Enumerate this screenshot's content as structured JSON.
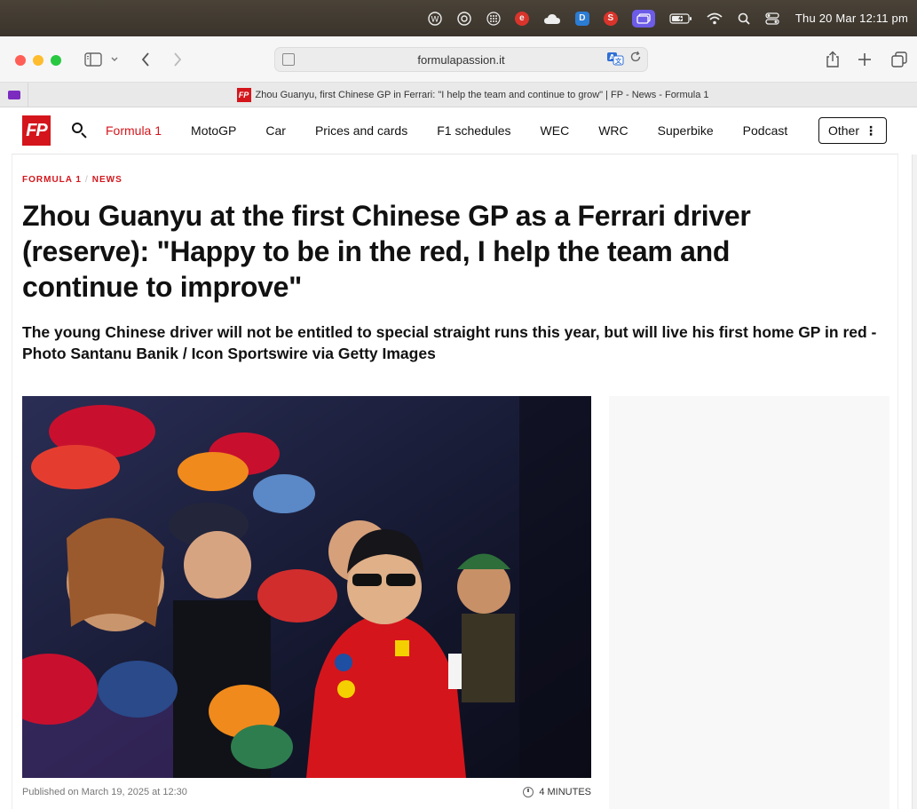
{
  "menubar": {
    "icons": [
      "wordpress-icon",
      "creative-cloud-icon",
      "grid-icon",
      "e-icon",
      "cloud-icon",
      "d-icon",
      "s-icon",
      "window-icon",
      "battery-icon",
      "wifi-icon",
      "search-icon",
      "control-center-icon"
    ],
    "e_label": "e",
    "d_label": "D",
    "s_label": "S",
    "clock": "Thu 20 Mar  12:11 pm"
  },
  "browser": {
    "url": "formulapassion.it",
    "tab_title": "Zhou Guanyu, first Chinese GP in Ferrari: \"I help the team and continue to grow\" | FP - News - Formula 1",
    "favicon": "FP"
  },
  "site": {
    "logo": "FP",
    "nav": [
      "Formula 1",
      "MotoGP",
      "Car",
      "Prices and cards",
      "F1 schedules",
      "WEC",
      "WRC",
      "Superbike",
      "Podcast"
    ],
    "other_label": "Other",
    "accent": "#d4161c"
  },
  "article": {
    "breadcrumb_1": "FORMULA 1",
    "breadcrumb_sep": "/",
    "breadcrumb_2": "NEWS",
    "headline": "Zhou Guanyu at the first Chinese GP as a Ferrari driver (reserve): \"Happy to be in the red, I help the team and continue to improve\"",
    "subhead": "The young Chinese driver will not be entitled to special straight runs this year, but will live his first home GP in red - Photo Santanu Banik / Icon Sportswire via Getty Images",
    "published": "Published on March 19, 2025 at 12:30",
    "read_time": "4 MINUTES"
  }
}
